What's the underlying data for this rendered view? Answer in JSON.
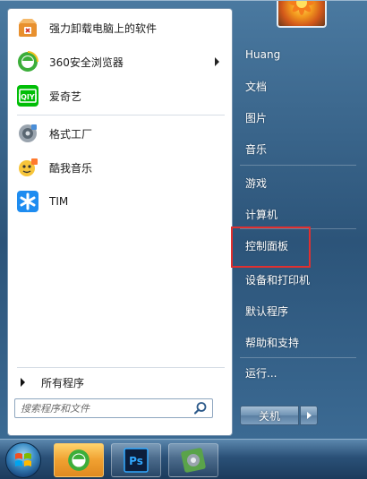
{
  "left_panel": {
    "programs": [
      {
        "label": "强力卸载电脑上的软件",
        "icon": "uninstall-box-icon",
        "has_submenu": false
      },
      {
        "label": "360安全浏览器",
        "icon": "360-browser-icon",
        "has_submenu": true
      },
      {
        "label": "爱奇艺",
        "icon": "iqiyi-icon",
        "has_submenu": false
      },
      {
        "label": "格式工厂",
        "icon": "format-factory-icon",
        "has_submenu": false
      },
      {
        "label": "酷我音乐",
        "icon": "kuwo-music-icon",
        "has_submenu": false
      },
      {
        "label": "TIM",
        "icon": "tim-icon",
        "has_submenu": false
      }
    ],
    "all_programs_label": "所有程序",
    "search_placeholder": "搜索程序和文件"
  },
  "right_panel": {
    "user_name": "Huang",
    "items": [
      "文档",
      "图片",
      "音乐",
      "游戏",
      "计算机",
      "控制面板",
      "设备和打印机",
      "默认程序",
      "帮助和支持",
      "运行..."
    ],
    "highlighted_item": "控制面板",
    "shutdown_label": "关机"
  },
  "taskbar": {
    "buttons": [
      {
        "name": "start-orb",
        "icon": "windows-logo-icon"
      },
      {
        "name": "360-browser",
        "icon": "360-browser-icon",
        "active": true
      },
      {
        "name": "photoshop",
        "icon": "photoshop-icon",
        "label": "Ps"
      },
      {
        "name": "format-factory",
        "icon": "format-factory-icon"
      }
    ]
  },
  "colors": {
    "highlight_border": "#e03030",
    "menu_blue": "#2c5479",
    "iqiyi_green": "#00be06",
    "tim_blue": "#1e8cf0",
    "photoshop_blue": "#0c1e3c"
  }
}
